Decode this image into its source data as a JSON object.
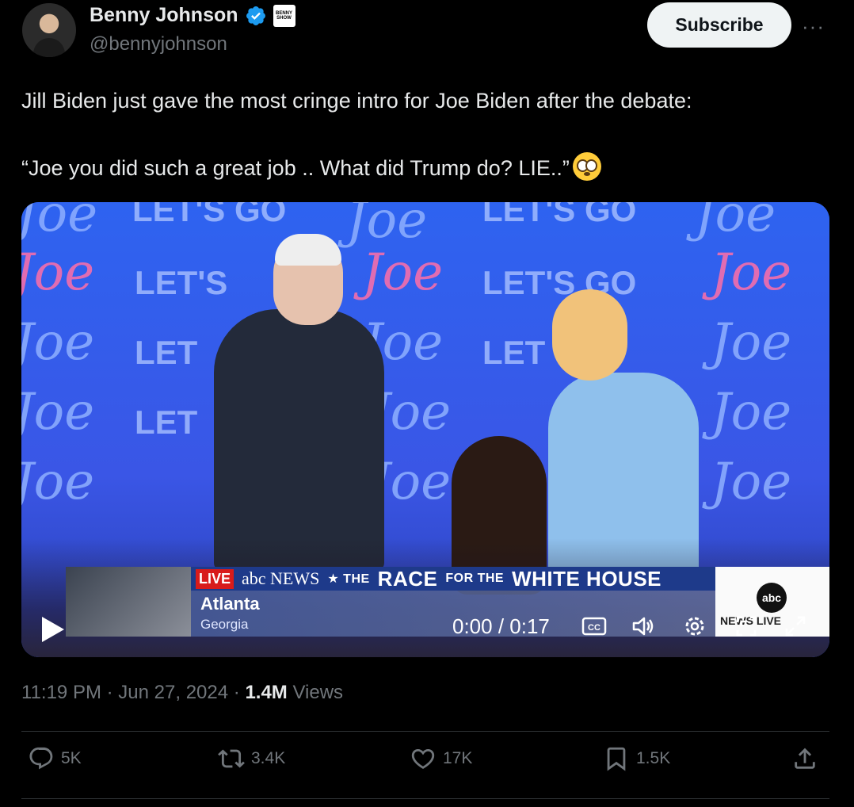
{
  "author": {
    "display_name": "Benny Johnson",
    "handle": "@bennyjohnson",
    "badge_text": "BENNY SHOW",
    "avatar": "avatar",
    "verified_icon": "verified-check-icon"
  },
  "header": {
    "subscribe_label": "Subscribe",
    "more_label": "···"
  },
  "tweet": {
    "line1": "Jill Biden just gave the most cringe intro for Joe Biden after the debate:",
    "line2": "“Joe you did such a great job .. What did Trump do? LIE..”",
    "emoji": "flushed-face-emoji"
  },
  "video": {
    "backdrop": {
      "joe": "Joe",
      "lets_go": "LET'S GO",
      "lets": "LET'S",
      "let": "LET"
    },
    "lower_third": {
      "live": "LIVE",
      "network": "abc NEWS",
      "race_prefix": "★ THE",
      "race": "RACE",
      "race_mid": "FOR THE",
      "race_suffix": "WHITE HOUSE",
      "city": "Atlanta",
      "state": "Georgia"
    },
    "corner": {
      "logo": "abc",
      "label": "NEWS LIVE"
    },
    "controls": {
      "time": "0:00 / 0:17",
      "play_icon": "play-icon",
      "cc_icon": "cc-icon",
      "volume_icon": "volume-icon",
      "settings_icon": "settings-icon",
      "pip_icon": "pip-icon",
      "fullscreen_icon": "fullscreen-icon"
    }
  },
  "meta": {
    "time": "11:19 PM",
    "sep1": "·",
    "date": "Jun 27, 2024",
    "sep2": "·",
    "views_count": "1.4M",
    "views_label": "Views"
  },
  "actions": {
    "replies": "5K",
    "reposts": "3.4K",
    "likes": "17K",
    "bookmarks": "1.5K"
  },
  "colors": {
    "background": "#000000",
    "text_primary": "#e7e9ea",
    "text_secondary": "#71767b",
    "verified_blue": "#1d9bf0",
    "divider": "#2f3336"
  }
}
